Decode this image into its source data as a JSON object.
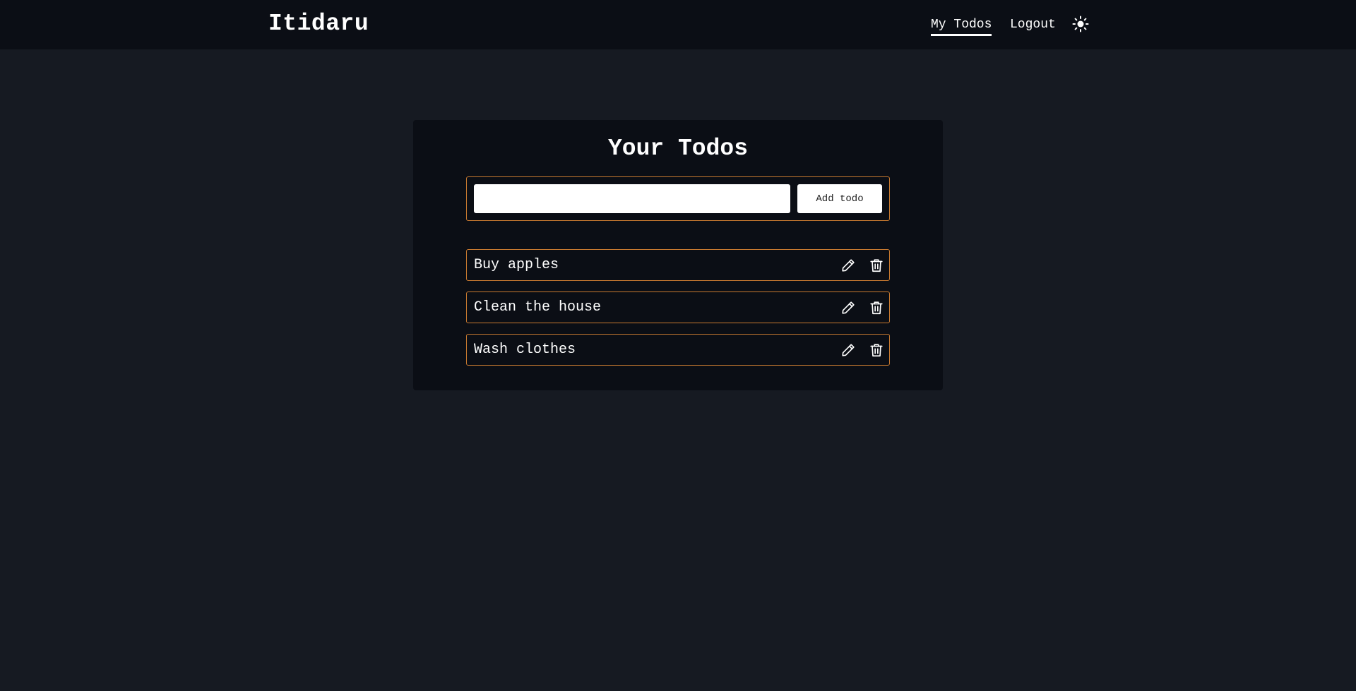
{
  "navbar": {
    "brand": "Itidaru",
    "links": {
      "my_todos": "My Todos",
      "logout": "Logout"
    },
    "theme_icon": "sun-icon"
  },
  "main": {
    "title": "Your Todos",
    "add_form": {
      "input_value": "",
      "button_label": "Add todo"
    },
    "todos": [
      {
        "text": "Buy apples"
      },
      {
        "text": "Clean the house"
      },
      {
        "text": "Wash clothes"
      }
    ]
  },
  "colors": {
    "background": "#161a22",
    "panel": "#0b0e15",
    "accent_border": "#c97a30",
    "text": "#ffffff"
  }
}
